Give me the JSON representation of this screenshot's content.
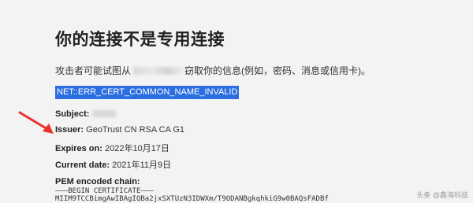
{
  "error": {
    "title": "你的连接不是专用连接",
    "desc_prefix": "攻击者可能试图从",
    "desc_suffix": "窃取你的信息(例如，密码、消息或信用卡)。",
    "code": "NET::ERR_CERT_COMMON_NAME_INVALID"
  },
  "cert": {
    "subject_label": "Subject:",
    "issuer_label": "Issuer:",
    "issuer_value": "GeoTrust CN RSA CA G1",
    "expires_label": "Expires on:",
    "expires_value": "2022年10月17日",
    "current_label": "Current date:",
    "current_value": "2021年11月9日",
    "pem_label": "PEM encoded chain:",
    "pem_begin": "———BEGIN CERTIFICATE———",
    "pem_data": "MIIM9TCCBimgAwIBAgIQBa2jxSXTUzN3IDWXm/T9ODANBgkqhkiG9w0BAQsFADBf"
  },
  "annotation": {
    "arrow_color": "#e8332b"
  },
  "watermark": "头条 @鑫海科技"
}
